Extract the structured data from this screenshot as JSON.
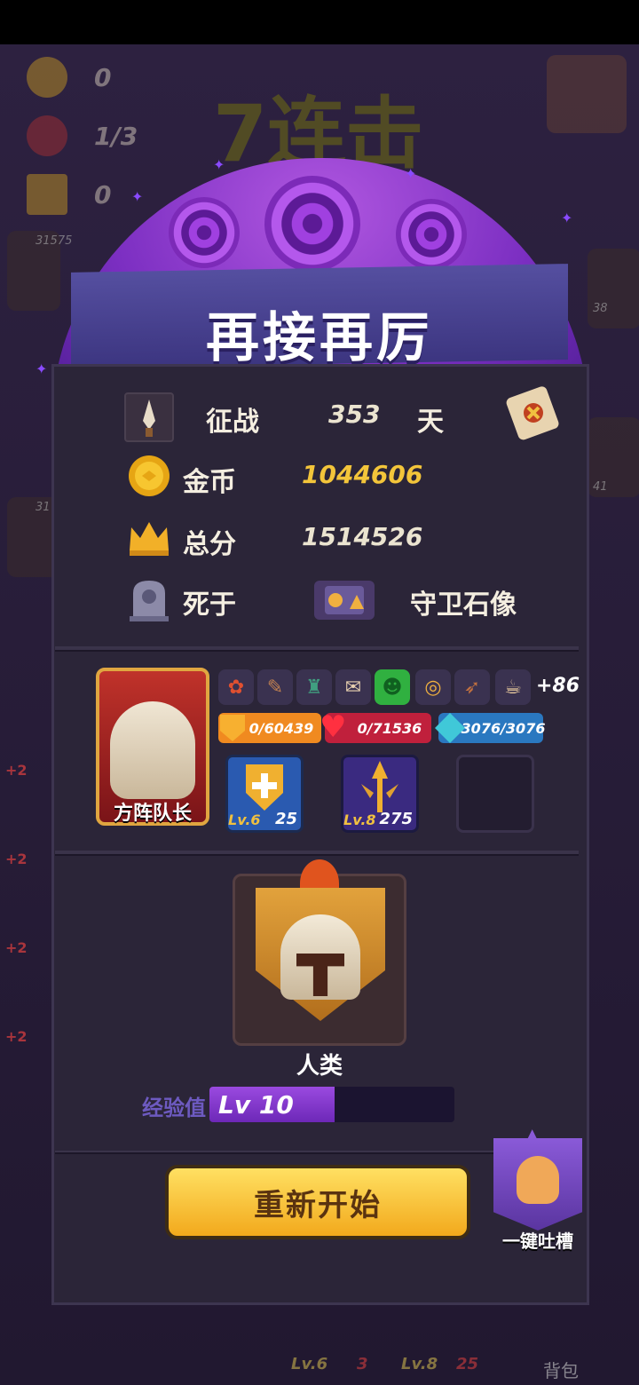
{
  "background": {
    "coins": "0",
    "kills": "1/3",
    "crowns": "0",
    "combo_text": "7连击",
    "side_numbers": [
      "38",
      "41"
    ],
    "side_scores": [
      "31575",
      "31"
    ],
    "plus_badges": [
      "+2",
      "+2",
      "+2",
      "+2"
    ],
    "bottom_lv6": "Lv.6",
    "bottom_lv6_count": "3",
    "bottom_lv8": "Lv.8",
    "bottom_lv8_count": "25",
    "bag_label": "背包"
  },
  "result": {
    "title": "再接再厉",
    "days_label": "征战",
    "days_value": "353",
    "days_unit": "天",
    "gold_label": "金币",
    "gold_value": "1044606",
    "score_label": "总分",
    "score_value": "1514526",
    "death_label": "死于",
    "death_cause": "守卫石像"
  },
  "hero": {
    "name": "方阵队长",
    "skills_more": "+86",
    "shield_stat": "0/60439",
    "hp_stat": "0/71536",
    "mana_stat": "3076/3076",
    "equip": [
      {
        "level": "Lv.6",
        "count": "25"
      },
      {
        "level": "Lv.8",
        "count": "275"
      }
    ]
  },
  "race": {
    "name": "人类",
    "exp_label": "经验值",
    "level_text": "Lv 10",
    "exp_progress": 0.51
  },
  "actions": {
    "restart_label": "重新开始",
    "feedback_label": "一键吐槽"
  },
  "colors": {
    "gold": "#f3c53a",
    "shield_bar": "#f08a20",
    "hp_bar": "#c0203c",
    "mana_bar": "#2a78c0",
    "exp_fill": "#8a3ed8"
  }
}
